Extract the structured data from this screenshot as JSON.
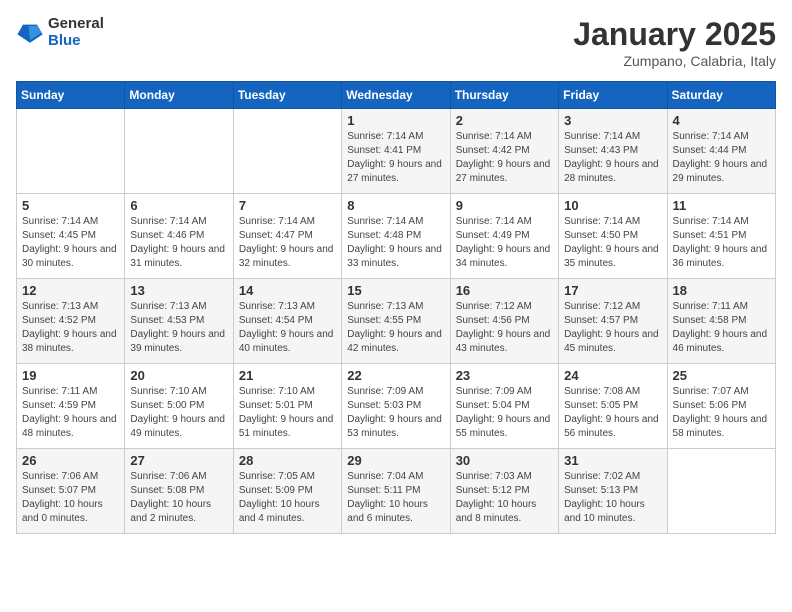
{
  "logo": {
    "general": "General",
    "blue": "Blue"
  },
  "title": "January 2025",
  "subtitle": "Zumpano, Calabria, Italy",
  "days_of_week": [
    "Sunday",
    "Monday",
    "Tuesday",
    "Wednesday",
    "Thursday",
    "Friday",
    "Saturday"
  ],
  "weeks": [
    [
      {
        "day": "",
        "info": ""
      },
      {
        "day": "",
        "info": ""
      },
      {
        "day": "",
        "info": ""
      },
      {
        "day": "1",
        "info": "Sunrise: 7:14 AM\nSunset: 4:41 PM\nDaylight: 9 hours and 27 minutes."
      },
      {
        "day": "2",
        "info": "Sunrise: 7:14 AM\nSunset: 4:42 PM\nDaylight: 9 hours and 27 minutes."
      },
      {
        "day": "3",
        "info": "Sunrise: 7:14 AM\nSunset: 4:43 PM\nDaylight: 9 hours and 28 minutes."
      },
      {
        "day": "4",
        "info": "Sunrise: 7:14 AM\nSunset: 4:44 PM\nDaylight: 9 hours and 29 minutes."
      }
    ],
    [
      {
        "day": "5",
        "info": "Sunrise: 7:14 AM\nSunset: 4:45 PM\nDaylight: 9 hours and 30 minutes."
      },
      {
        "day": "6",
        "info": "Sunrise: 7:14 AM\nSunset: 4:46 PM\nDaylight: 9 hours and 31 minutes."
      },
      {
        "day": "7",
        "info": "Sunrise: 7:14 AM\nSunset: 4:47 PM\nDaylight: 9 hours and 32 minutes."
      },
      {
        "day": "8",
        "info": "Sunrise: 7:14 AM\nSunset: 4:48 PM\nDaylight: 9 hours and 33 minutes."
      },
      {
        "day": "9",
        "info": "Sunrise: 7:14 AM\nSunset: 4:49 PM\nDaylight: 9 hours and 34 minutes."
      },
      {
        "day": "10",
        "info": "Sunrise: 7:14 AM\nSunset: 4:50 PM\nDaylight: 9 hours and 35 minutes."
      },
      {
        "day": "11",
        "info": "Sunrise: 7:14 AM\nSunset: 4:51 PM\nDaylight: 9 hours and 36 minutes."
      }
    ],
    [
      {
        "day": "12",
        "info": "Sunrise: 7:13 AM\nSunset: 4:52 PM\nDaylight: 9 hours and 38 minutes."
      },
      {
        "day": "13",
        "info": "Sunrise: 7:13 AM\nSunset: 4:53 PM\nDaylight: 9 hours and 39 minutes."
      },
      {
        "day": "14",
        "info": "Sunrise: 7:13 AM\nSunset: 4:54 PM\nDaylight: 9 hours and 40 minutes."
      },
      {
        "day": "15",
        "info": "Sunrise: 7:13 AM\nSunset: 4:55 PM\nDaylight: 9 hours and 42 minutes."
      },
      {
        "day": "16",
        "info": "Sunrise: 7:12 AM\nSunset: 4:56 PM\nDaylight: 9 hours and 43 minutes."
      },
      {
        "day": "17",
        "info": "Sunrise: 7:12 AM\nSunset: 4:57 PM\nDaylight: 9 hours and 45 minutes."
      },
      {
        "day": "18",
        "info": "Sunrise: 7:11 AM\nSunset: 4:58 PM\nDaylight: 9 hours and 46 minutes."
      }
    ],
    [
      {
        "day": "19",
        "info": "Sunrise: 7:11 AM\nSunset: 4:59 PM\nDaylight: 9 hours and 48 minutes."
      },
      {
        "day": "20",
        "info": "Sunrise: 7:10 AM\nSunset: 5:00 PM\nDaylight: 9 hours and 49 minutes."
      },
      {
        "day": "21",
        "info": "Sunrise: 7:10 AM\nSunset: 5:01 PM\nDaylight: 9 hours and 51 minutes."
      },
      {
        "day": "22",
        "info": "Sunrise: 7:09 AM\nSunset: 5:03 PM\nDaylight: 9 hours and 53 minutes."
      },
      {
        "day": "23",
        "info": "Sunrise: 7:09 AM\nSunset: 5:04 PM\nDaylight: 9 hours and 55 minutes."
      },
      {
        "day": "24",
        "info": "Sunrise: 7:08 AM\nSunset: 5:05 PM\nDaylight: 9 hours and 56 minutes."
      },
      {
        "day": "25",
        "info": "Sunrise: 7:07 AM\nSunset: 5:06 PM\nDaylight: 9 hours and 58 minutes."
      }
    ],
    [
      {
        "day": "26",
        "info": "Sunrise: 7:06 AM\nSunset: 5:07 PM\nDaylight: 10 hours and 0 minutes."
      },
      {
        "day": "27",
        "info": "Sunrise: 7:06 AM\nSunset: 5:08 PM\nDaylight: 10 hours and 2 minutes."
      },
      {
        "day": "28",
        "info": "Sunrise: 7:05 AM\nSunset: 5:09 PM\nDaylight: 10 hours and 4 minutes."
      },
      {
        "day": "29",
        "info": "Sunrise: 7:04 AM\nSunset: 5:11 PM\nDaylight: 10 hours and 6 minutes."
      },
      {
        "day": "30",
        "info": "Sunrise: 7:03 AM\nSunset: 5:12 PM\nDaylight: 10 hours and 8 minutes."
      },
      {
        "day": "31",
        "info": "Sunrise: 7:02 AM\nSunset: 5:13 PM\nDaylight: 10 hours and 10 minutes."
      },
      {
        "day": "",
        "info": ""
      }
    ]
  ]
}
